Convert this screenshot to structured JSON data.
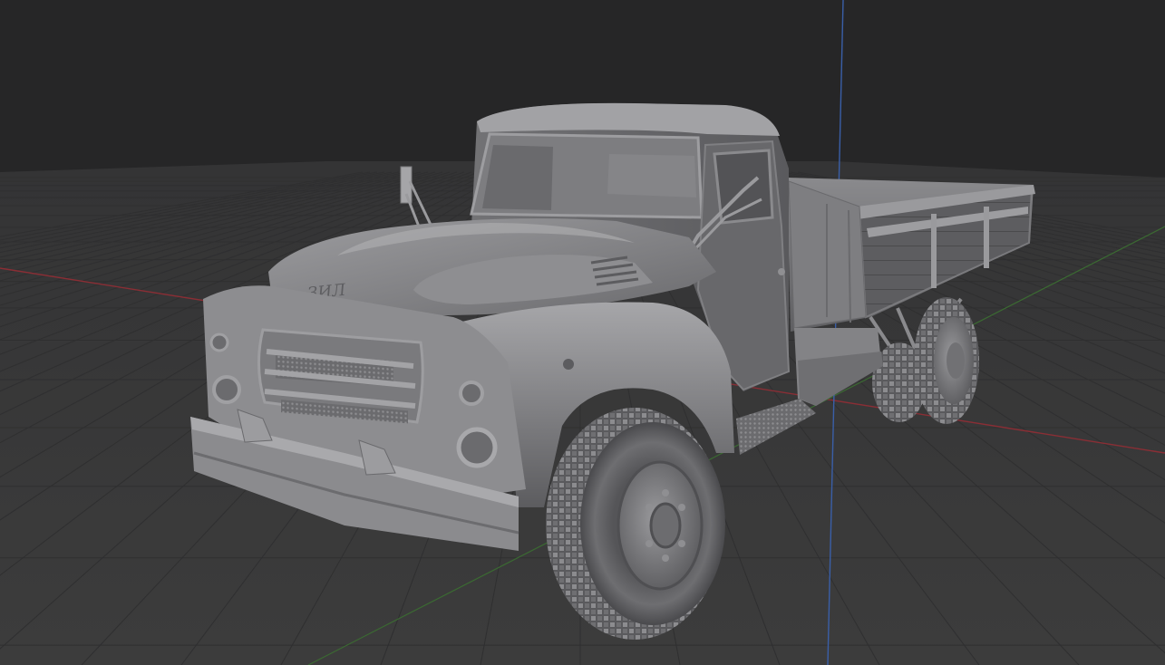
{
  "viewport": {
    "background_color": "#393939",
    "sky_color": "#262627",
    "grid_color": "#2f2f30",
    "axis_x_color": "#8a2e35",
    "axis_y_color": "#3b6a32",
    "axis_z_color": "#3a5fa8"
  },
  "model": {
    "emblem_text": "ЗИЛ",
    "material_color": "#8a8a8d",
    "shading": "solid"
  }
}
